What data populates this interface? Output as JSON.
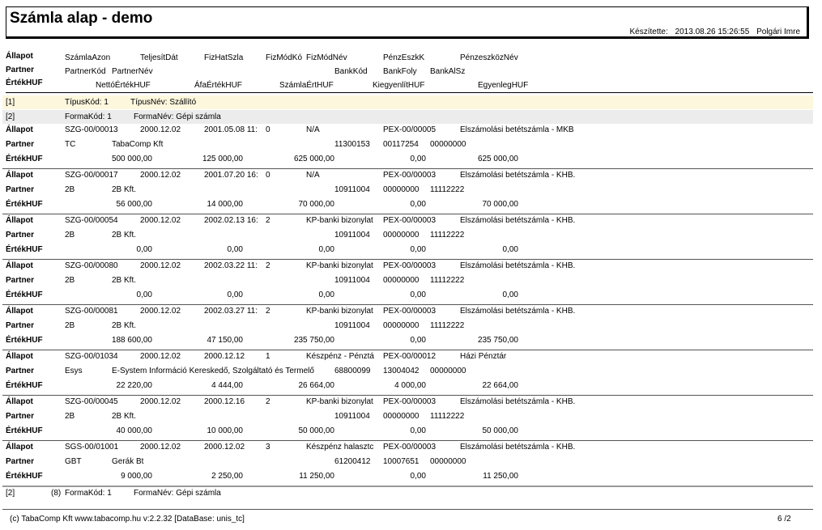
{
  "report": {
    "title": "Számla alap - demo",
    "created_label": "Készítette:",
    "created_date": "2013.08.26 15:26:55",
    "created_by": "Polgári Imre"
  },
  "columns": {
    "row1": [
      "Állapot",
      "SzámlaAzon",
      "TeljesítDát",
      "FizHatSzla",
      "FizMódKó",
      "FizMódNév",
      "PénzEszkK",
      "PénzeszközNév"
    ],
    "row2": [
      "Partner",
      "PartnerKód",
      "PartnerNév",
      "BankKód",
      "BankFoly",
      "BankAlSz"
    ],
    "row3": [
      "ÉrtékHUF",
      "NettóÉrtékHUF",
      "ÁfaÉrtékHUF",
      "SzámlaÉrtHUF",
      "KiegyenlítHUF",
      "EgyenlegHUF"
    ]
  },
  "groups": {
    "g1": {
      "num": "[1]",
      "kod": "TípusKód:  1",
      "nev": "TípusNév:  Szállító"
    },
    "g2": {
      "num": "[2]",
      "kod": "FormaKód:  1",
      "nev": "FormaNév:  Gépi számla"
    }
  },
  "labels": {
    "allapot": "Állapot",
    "partner": "Partner",
    "ertek": "ÉrtékHUF"
  },
  "records": [
    {
      "azon": "SZG-00/00013",
      "telj": "2000.12.02",
      "fizhat": "2001.05.08 11:",
      "fizmod": "0",
      "fizmodnev": "N/A",
      "penzk": "PEX-00/00005",
      "penznev": "Elszámolási betétszámla - MKB",
      "pkod": "TC",
      "pnev": "TabaComp Kft",
      "bankkod": "11300153",
      "bankfoly": "00117254",
      "bankal": "00000000",
      "netto": "500 000,00",
      "afa": "125 000,00",
      "szamla": "625 000,00",
      "kiegy": "0,00",
      "egyenleg": "625 000,00"
    },
    {
      "azon": "SZG-00/00017",
      "telj": "2000.12.02",
      "fizhat": "2001.07.20 16:",
      "fizmod": "0",
      "fizmodnev": "N/A",
      "penzk": "PEX-00/00003",
      "penznev": "Elszámolási betétszámla - KHB.",
      "pkod": "2B",
      "pnev": "2B Kft.",
      "bankkod": "10911004",
      "bankfoly": "00000000",
      "bankal": "11112222",
      "netto": "56 000,00",
      "afa": "14 000,00",
      "szamla": "70 000,00",
      "kiegy": "0,00",
      "egyenleg": "70 000,00"
    },
    {
      "azon": "SZG-00/00054",
      "telj": "2000.12.02",
      "fizhat": "2002.02.13 16:",
      "fizmod": "2",
      "fizmodnev": "KP-banki bizonylat",
      "penzk": "PEX-00/00003",
      "penznev": "Elszámolási betétszámla - KHB.",
      "pkod": "2B",
      "pnev": "2B Kft.",
      "bankkod": "10911004",
      "bankfoly": "00000000",
      "bankal": "11112222",
      "netto": "0,00",
      "afa": "0,00",
      "szamla": "0,00",
      "kiegy": "0,00",
      "egyenleg": "0,00"
    },
    {
      "azon": "SZG-00/00080",
      "telj": "2000.12.02",
      "fizhat": "2002.03.22 11:",
      "fizmod": "2",
      "fizmodnev": "KP-banki bizonylat",
      "penzk": "PEX-00/00003",
      "penznev": "Elszámolási betétszámla - KHB.",
      "pkod": "2B",
      "pnev": "2B Kft.",
      "bankkod": "10911004",
      "bankfoly": "00000000",
      "bankal": "11112222",
      "netto": "0,00",
      "afa": "0,00",
      "szamla": "0,00",
      "kiegy": "0,00",
      "egyenleg": "0,00"
    },
    {
      "azon": "SZG-00/00081",
      "telj": "2000.12.02",
      "fizhat": "2002.03.27 11:",
      "fizmod": "2",
      "fizmodnev": "KP-banki bizonylat",
      "penzk": "PEX-00/00003",
      "penznev": "Elszámolási betétszámla - KHB.",
      "pkod": "2B",
      "pnev": "2B Kft.",
      "bankkod": "10911004",
      "bankfoly": "00000000",
      "bankal": "11112222",
      "netto": "188 600,00",
      "afa": "47 150,00",
      "szamla": "235 750,00",
      "kiegy": "0,00",
      "egyenleg": "235 750,00"
    },
    {
      "azon": "SZG-00/01034",
      "telj": "2000.12.02",
      "fizhat": "2000.12.12",
      "fizmod": "1",
      "fizmodnev": "Készpénz - Pénztá",
      "penzk": "PEX-00/00012",
      "penznev": "Házi Pénztár",
      "pkod": "Esys",
      "pnev": "E-System Információ Kereskedő, Szolgáltató és Termelő",
      "bankkod": "68800099",
      "bankfoly": "13004042",
      "bankal": "00000000",
      "netto": "22 220,00",
      "afa": "4 444,00",
      "szamla": "26 664,00",
      "kiegy": "4 000,00",
      "egyenleg": "22 664,00"
    },
    {
      "azon": "SZG-00/00045",
      "telj": "2000.12.02",
      "fizhat": "2000.12.16",
      "fizmod": "2",
      "fizmodnev": "KP-banki bizonylat",
      "penzk": "PEX-00/00003",
      "penznev": "Elszámolási betétszámla - KHB.",
      "pkod": "2B",
      "pnev": "2B Kft.",
      "bankkod": "10911004",
      "bankfoly": "00000000",
      "bankal": "11112222",
      "netto": "40 000,00",
      "afa": "10 000,00",
      "szamla": "50 000,00",
      "kiegy": "0,00",
      "egyenleg": "50 000,00"
    },
    {
      "azon": "SGS-00/01001",
      "telj": "2000.12.02",
      "fizhat": "2000.12.02",
      "fizmod": "3",
      "fizmodnev": "Készpénz halasztc",
      "penzk": "PEX-00/00003",
      "penznev": "Elszámolási betétszámla - KHB.",
      "pkod": "GBT",
      "pnev": "Gerák Bt",
      "bankkod": "61200412",
      "bankfoly": "10007651",
      "bankal": "00000000",
      "netto": "9 000,00",
      "afa": "2 250,00",
      "szamla": "11 250,00",
      "kiegy": "0,00",
      "egyenleg": "11 250,00"
    }
  ],
  "group_footer": {
    "num": "[2]",
    "count": "(8)",
    "kod": "FormaKód:  1",
    "nev": "FormaNév:  Gépi számla"
  },
  "footer": {
    "left": "(c) TabaComp Kft  www.tabacomp.hu  v:2.2.32 [DataBase: unis_tc]",
    "page": "6  /2"
  }
}
